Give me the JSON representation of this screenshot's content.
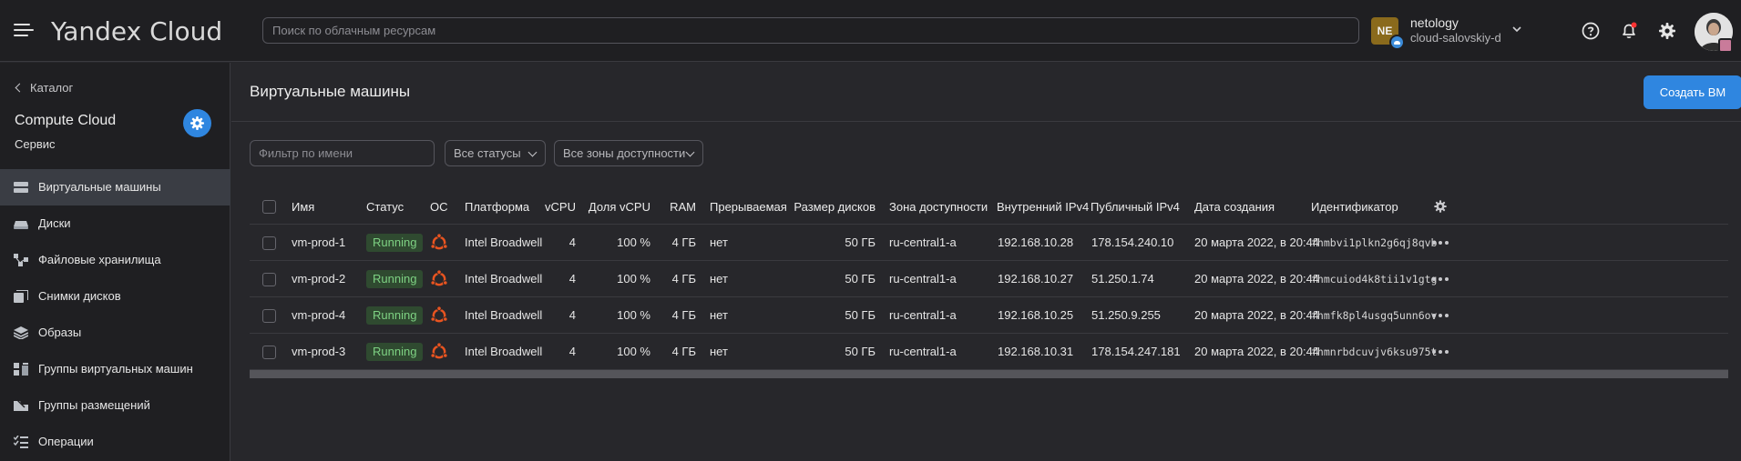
{
  "header": {
    "logo": "Yandex Cloud",
    "search_placeholder": "Поиск по облачным ресурсам",
    "account": {
      "initials": "NE",
      "name": "netology",
      "cloud": "cloud-salovskiy-d"
    }
  },
  "sidebar": {
    "back_label": "Каталог",
    "service_title": "Compute Cloud",
    "service_subtitle": "Сервис",
    "items": [
      {
        "label": "Виртуальные машины",
        "icon": "server-icon",
        "active": true
      },
      {
        "label": "Диски",
        "icon": "disk-icon",
        "active": false
      },
      {
        "label": "Файловые хранилища",
        "icon": "file-storage-icon",
        "active": false
      },
      {
        "label": "Снимки дисков",
        "icon": "snapshot-icon",
        "active": false
      },
      {
        "label": "Образы",
        "icon": "layers-icon",
        "active": false
      },
      {
        "label": "Группы виртуальных машин",
        "icon": "instance-group-icon",
        "active": false
      },
      {
        "label": "Группы размещений",
        "icon": "placement-group-icon",
        "active": false
      },
      {
        "label": "Операции",
        "icon": "operations-icon",
        "active": false
      }
    ]
  },
  "main": {
    "title": "Виртуальные машины",
    "create_button": "Создать ВМ",
    "filters": {
      "name_placeholder": "Фильтр по имени",
      "status_select": "Все статусы",
      "zone_select": "Все зоны доступности"
    },
    "table": {
      "columns": {
        "name": "Имя",
        "status": "Статус",
        "os": "ОС",
        "platform": "Платформа",
        "vcpu": "vCPU",
        "vcpu_share": "Доля vCPU",
        "ram": "RAM",
        "preemptible": "Прерываемая",
        "disk_size": "Размер дисков",
        "zone": "Зона доступности",
        "internal_ip": "Внутренний IPv4",
        "public_ip": "Публичный IPv4",
        "created": "Дата создания",
        "id": "Идентификатор"
      },
      "rows": [
        {
          "name": "vm-prod-1",
          "status": "Running",
          "platform": "Intel Broadwell",
          "vcpu": "4",
          "vcpu_share": "100 %",
          "ram": "4 ГБ",
          "preemptible": "нет",
          "disk_size": "50 ГБ",
          "zone": "ru-central1-a",
          "internal_ip": "192.168.10.28",
          "public_ip": "178.154.240.10",
          "created": "20 марта 2022, в 20:44",
          "id": "fhmbvi1plkn2g6qj8qvb"
        },
        {
          "name": "vm-prod-2",
          "status": "Running",
          "platform": "Intel Broadwell",
          "vcpu": "4",
          "vcpu_share": "100 %",
          "ram": "4 ГБ",
          "preemptible": "нет",
          "disk_size": "50 ГБ",
          "zone": "ru-central1-a",
          "internal_ip": "192.168.10.27",
          "public_ip": "51.250.1.74",
          "created": "20 марта 2022, в 20:44",
          "id": "fhmcuiod4k8tii1v1gtg"
        },
        {
          "name": "vm-prod-4",
          "status": "Running",
          "platform": "Intel Broadwell",
          "vcpu": "4",
          "vcpu_share": "100 %",
          "ram": "4 ГБ",
          "preemptible": "нет",
          "disk_size": "50 ГБ",
          "zone": "ru-central1-a",
          "internal_ip": "192.168.10.25",
          "public_ip": "51.250.9.255",
          "created": "20 марта 2022, в 20:44",
          "id": "fhmfk8pl4usgq5unn6ov"
        },
        {
          "name": "vm-prod-3",
          "status": "Running",
          "platform": "Intel Broadwell",
          "vcpu": "4",
          "vcpu_share": "100 %",
          "ram": "4 ГБ",
          "preemptible": "нет",
          "disk_size": "50 ГБ",
          "zone": "ru-central1-a",
          "internal_ip": "192.168.10.31",
          "public_ip": "178.154.247.181",
          "created": "20 марта 2022, в 20:44",
          "id": "fhmnrbdcuvjv6ksu975t"
        }
      ]
    }
  },
  "colors": {
    "accent": "#2f86e0",
    "running_bg": "#2f4a30",
    "running_text": "#7ed283",
    "ubuntu": "#e95420",
    "notification_dot": "#ff3333"
  },
  "icons": [
    "menu-icon",
    "help-icon",
    "bell-icon",
    "gear-icon",
    "chevron-down-icon",
    "settings-icon",
    "ubuntu-icon",
    "more-icon"
  ]
}
